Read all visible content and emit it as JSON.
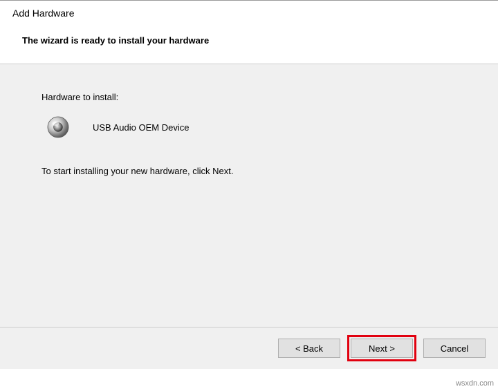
{
  "header": {
    "title": "Add Hardware",
    "subtitle": "The wizard is ready to install your hardware"
  },
  "content": {
    "label": "Hardware to install:",
    "device_name": "USB Audio OEM Device",
    "instruction": "To start installing your new hardware, click Next."
  },
  "footer": {
    "back_label": "< Back",
    "next_label": "Next >",
    "cancel_label": "Cancel"
  },
  "watermark": "wsxdn.com"
}
